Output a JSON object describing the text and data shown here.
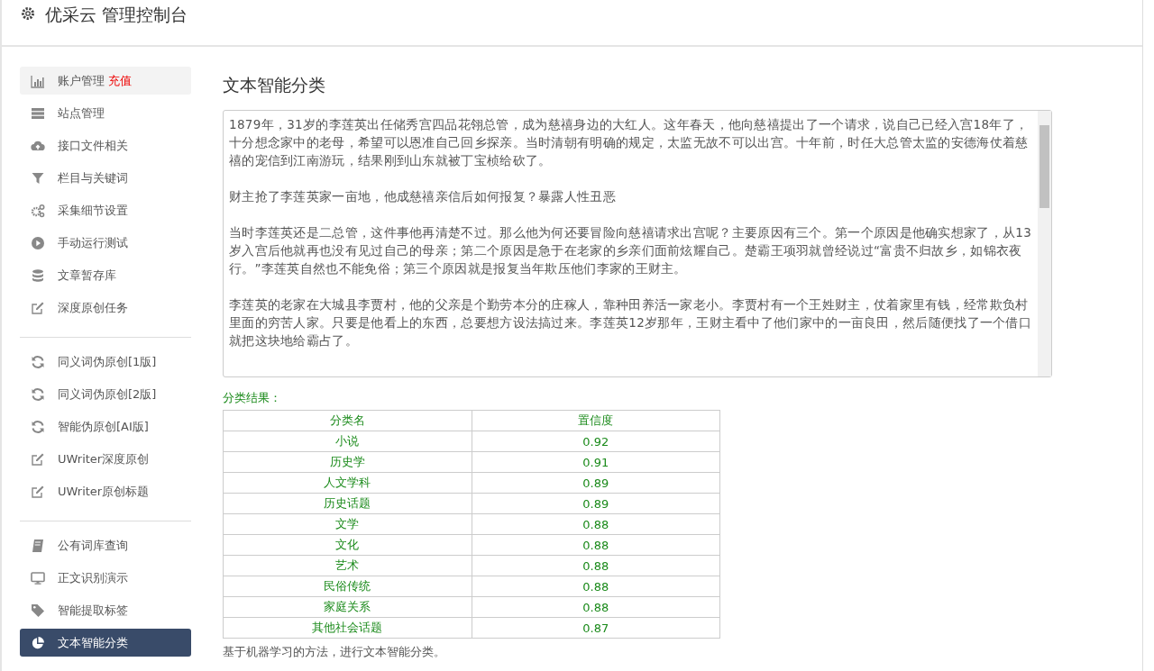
{
  "header": {
    "title": "优采云 管理控制台"
  },
  "sidebar": {
    "groups": [
      {
        "items": [
          {
            "label": "账户管理",
            "badge": "充值",
            "selected": false,
            "highlighted": true
          },
          {
            "label": "站点管理",
            "selected": false,
            "highlighted": false
          },
          {
            "label": "接口文件相关",
            "selected": false,
            "highlighted": false
          },
          {
            "label": "栏目与关键词",
            "selected": false,
            "highlighted": false
          },
          {
            "label": "采集细节设置",
            "selected": false,
            "highlighted": false
          },
          {
            "label": "手动运行测试",
            "selected": false,
            "highlighted": false
          },
          {
            "label": "文章暂存库",
            "selected": false,
            "highlighted": false
          },
          {
            "label": "深度原创任务",
            "selected": false,
            "highlighted": false
          }
        ]
      },
      {
        "items": [
          {
            "label": "同义词伪原创[1版]",
            "selected": false,
            "highlighted": false
          },
          {
            "label": "同义词伪原创[2版]",
            "selected": false,
            "highlighted": false
          },
          {
            "label": "智能伪原创[AI版]",
            "selected": false,
            "highlighted": false
          },
          {
            "label": "UWriter深度原创",
            "selected": false,
            "highlighted": false
          },
          {
            "label": "UWriter原创标题",
            "selected": false,
            "highlighted": false
          }
        ]
      },
      {
        "items": [
          {
            "label": "公有词库查询",
            "selected": false,
            "highlighted": false
          },
          {
            "label": "正文识别演示",
            "selected": false,
            "highlighted": false
          },
          {
            "label": "智能提取标签",
            "selected": false,
            "highlighted": false
          },
          {
            "label": "文本智能分类",
            "selected": true,
            "highlighted": false
          }
        ]
      }
    ]
  },
  "main": {
    "title": "文本智能分类",
    "text_input": {
      "paragraphs": [
        "1879年，31岁的李莲英出任储秀宫四品花翎总管，成为慈禧身边的大红人。这年春天，他向慈禧提出了一个请求，说自己已经入宫18年了，十分想念家中的老母，希望可以恩准自己回乡探亲。当时清朝有明确的规定，太监无故不可以出宫。十年前，时任大总管太监的安德海仗着慈禧的宠信到江南游玩，结果刚到山东就被丁宝桢给砍了。",
        "财主抢了李莲英家一亩地，他成慈禧亲信后如何报复？暴露人性丑恶",
        "当时李莲英还是二总管，这件事他再清楚不过。那么他为何还要冒险向慈禧请求出宫呢？主要原因有三个。第一个原因是他确实想家了，从13岁入宫后他就再也没有见过自己的母亲；第二个原因是急于在老家的乡亲们面前炫耀自己。楚霸王项羽就曾经说过“富贵不归故乡，如锦衣夜行。”李莲英自然也不能免俗；第三个原因就是报复当年欺压他们李家的王财主。",
        "李莲英的老家在大城县李贾村，他的父亲是个勤劳本分的庄稼人，靠种田养活一家老小。李贾村有一个王姓财主，仗着家里有钱，经常欺负村里面的穷苦人家。只要是他看上的东西，总要想方设法搞过来。李莲英12岁那年，王财主看中了他们家中的一亩良田，然后随便找了一个借口就把这块地给霸占了。"
      ]
    },
    "result_label": "分类结果：",
    "table": {
      "columns": [
        "分类名",
        "置信度"
      ],
      "rows": [
        [
          "小说",
          "0.92"
        ],
        [
          "历史学",
          "0.91"
        ],
        [
          "人文学科",
          "0.89"
        ],
        [
          "历史话题",
          "0.89"
        ],
        [
          "文学",
          "0.88"
        ],
        [
          "文化",
          "0.88"
        ],
        [
          "艺术",
          "0.88"
        ],
        [
          "民俗传统",
          "0.88"
        ],
        [
          "家庭关系",
          "0.88"
        ],
        [
          "其他社会话题",
          "0.87"
        ]
      ]
    },
    "note": "基于机器学习的方法，进行文本智能分类。"
  }
}
